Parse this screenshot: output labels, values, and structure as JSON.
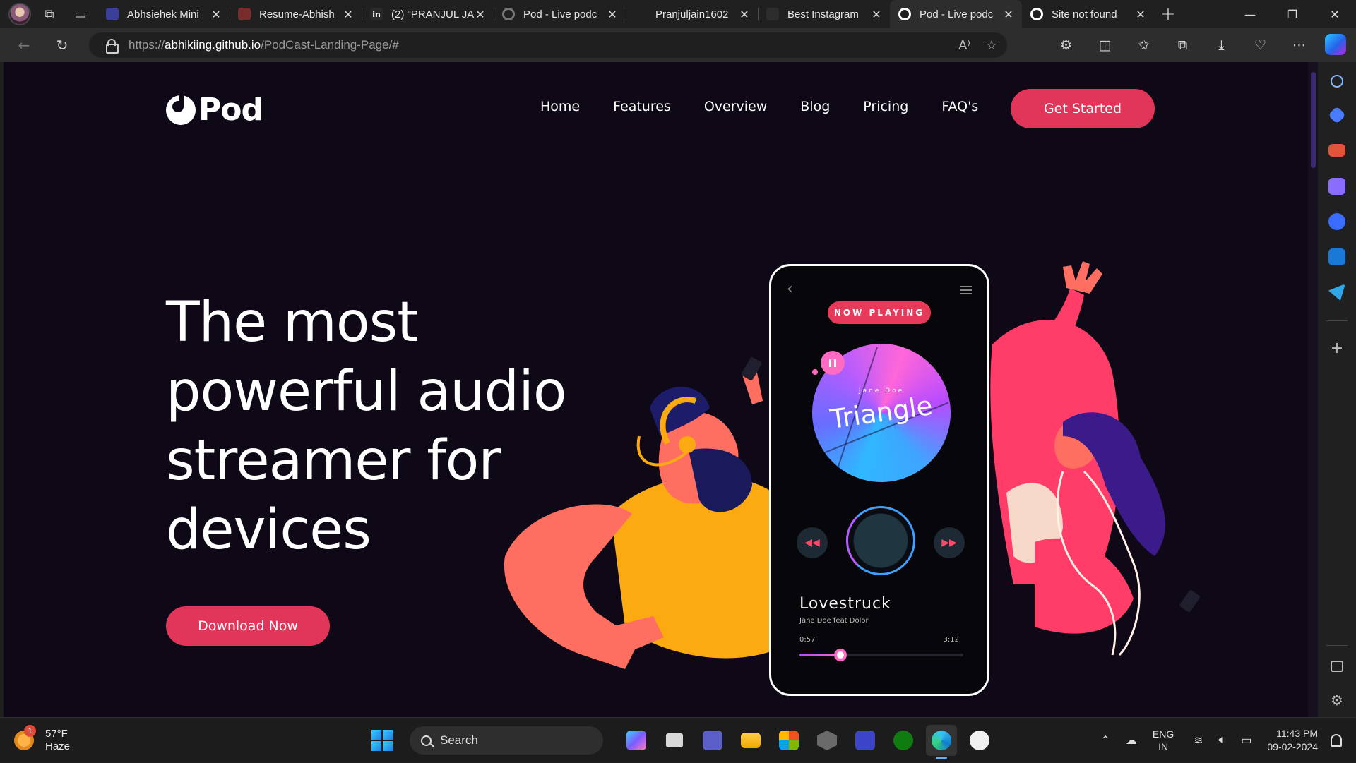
{
  "browser": {
    "tabs": [
      {
        "title": "Abhsiehek Mini",
        "favicon_color": "#3b3f9a",
        "favicon_icon": "profile-image-icon"
      },
      {
        "title": "Resume-Abhish",
        "favicon_color": "#7a2c2c",
        "favicon_icon": "pdf-icon"
      },
      {
        "title": "(2) \"PRANJUL JA",
        "favicon_color": "#2a2a2a",
        "favicon_icon": "linkedin-icon",
        "favicon_text": "in"
      },
      {
        "title": "Pod - Live podc",
        "favicon_color": "#3a3a3a",
        "favicon_icon": "pod-logo-icon"
      },
      {
        "title": "Pranjuljain1602",
        "favicon_color": "#202020",
        "favicon_icon": "github-icon"
      },
      {
        "title": "Best Instagram",
        "favicon_color": "#2d2d2d",
        "favicon_icon": "document-icon"
      },
      {
        "title": "Pod - Live podc",
        "favicon_color": "#ffffff",
        "favicon_icon": "pod-logo-icon",
        "active": true
      },
      {
        "title": "Site not found",
        "favicon_color": "#ffffff",
        "favicon_icon": "pod-logo-icon"
      }
    ],
    "close_glyph": "✕",
    "new_tab_glyph": "+",
    "address": {
      "prefix": "https://",
      "domain": "abhikiing.github.io",
      "path": "/PodCast-Landing-Page/#"
    },
    "window_controls": {
      "minimize": "—",
      "restore": "❐",
      "close": "✕"
    }
  },
  "site": {
    "logo_text": "Pod",
    "nav": [
      "Home",
      "Features",
      "Overview",
      "Blog",
      "Pricing",
      "FAQ's"
    ],
    "cta": "Get Started",
    "hero_title": "The most powerful audio streamer for devices",
    "download_button": "Download Now",
    "phone": {
      "badge": "NOW PLAYING",
      "album_artist": "Jane Doe",
      "album_title": "Triangle",
      "song_title": "Lovestruck",
      "song_artist": "Jane Doe feat Dolor",
      "elapsed": "0:57",
      "duration": "3:12",
      "progress": 0.25
    },
    "colors": {
      "background": "#0f0817",
      "accent": "#e2355a"
    }
  },
  "taskbar": {
    "weather_temp": "57°F",
    "weather_desc": "Haze",
    "weather_badge": "1",
    "search_label": "Search",
    "language": "ENG",
    "region": "IN",
    "time": "11:43 PM",
    "date": "09-02-2024"
  }
}
